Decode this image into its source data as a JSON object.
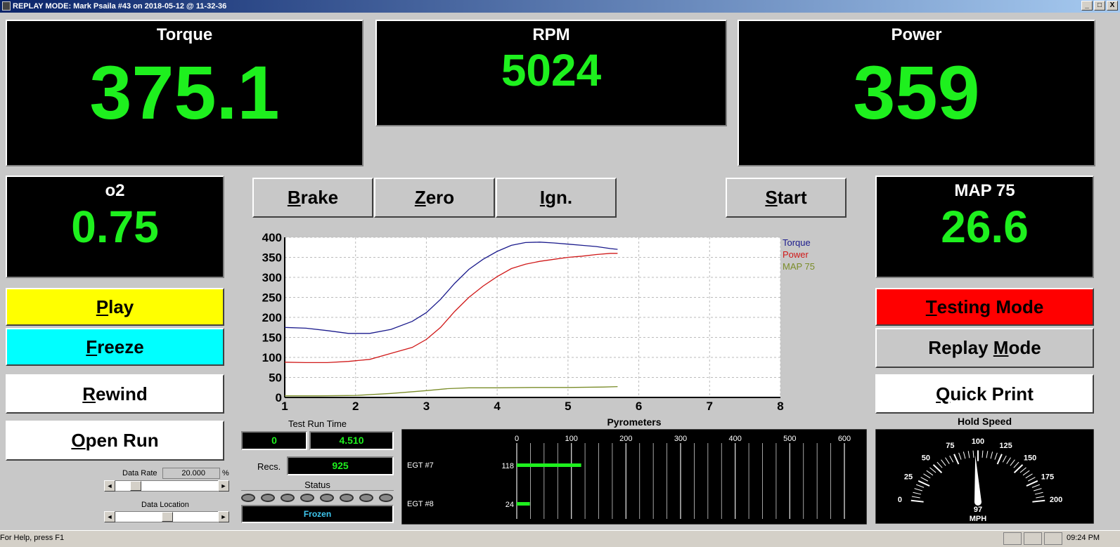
{
  "window": {
    "title": "REPLAY MODE: Mark Psaila #43 on 2018-05-12 @ 11-32-36",
    "min": "_",
    "max": "□",
    "close": "X"
  },
  "torque": {
    "label": "Torque",
    "value": "375.1"
  },
  "rpm": {
    "label": "RPM",
    "value": "5024"
  },
  "power": {
    "label": "Power",
    "value": "359"
  },
  "o2": {
    "label": "o2",
    "value": "0.75"
  },
  "map": {
    "label": "MAP 75",
    "value": "26.6"
  },
  "buttons": {
    "brake": {
      "first": "B",
      "rest": "rake"
    },
    "zero": {
      "first": "Z",
      "rest": "ero"
    },
    "ign": {
      "first": "I",
      "rest": "gn."
    },
    "start": {
      "first": "S",
      "rest": "tart"
    },
    "play": {
      "first": "P",
      "rest": "lay"
    },
    "freeze": {
      "first": "F",
      "rest": "reeze"
    },
    "rewind": {
      "first": "R",
      "rest": "ewind"
    },
    "open_run": {
      "first": "O",
      "rest": "pen Run"
    },
    "testing_mode": {
      "first": "T",
      "rest": "esting Mode"
    },
    "replay_mode": {
      "pre": "Replay ",
      "u": "M",
      "post": "ode"
    },
    "quick_print": {
      "first": "Q",
      "rest": "uick Print"
    }
  },
  "colors": {
    "torque": "#1a1a8c",
    "power": "#d01818",
    "map": "#7a8c28",
    "digits": "#1ef01e",
    "play": "#ffff00",
    "freeze": "#00ffff",
    "testing": "#ff0000"
  },
  "chart_data": {
    "type": "line",
    "xlim": [
      1,
      8
    ],
    "ylim": [
      0,
      400
    ],
    "xticks": [
      "1",
      "2",
      "3",
      "4",
      "5",
      "6",
      "7",
      "8"
    ],
    "yticks": [
      "0",
      "50",
      "100",
      "150",
      "200",
      "250",
      "300",
      "350",
      "400"
    ],
    "grid": true,
    "legend": "top-right",
    "series": [
      {
        "name": "Torque",
        "x": [
          1,
          1.3,
          1.6,
          1.9,
          2.2,
          2.5,
          2.8,
          3.0,
          3.2,
          3.4,
          3.6,
          3.8,
          4.0,
          4.2,
          4.4,
          4.6,
          4.8,
          5.0,
          5.2,
          5.4,
          5.6,
          5.7
        ],
        "y": [
          175,
          173,
          167,
          160,
          160,
          170,
          190,
          212,
          245,
          285,
          320,
          345,
          365,
          380,
          387,
          388,
          386,
          383,
          380,
          377,
          372,
          370
        ]
      },
      {
        "name": "Power",
        "x": [
          1,
          1.3,
          1.6,
          1.9,
          2.2,
          2.5,
          2.8,
          3.0,
          3.2,
          3.4,
          3.6,
          3.8,
          4.0,
          4.2,
          4.4,
          4.6,
          4.8,
          5.0,
          5.2,
          5.4,
          5.6,
          5.7
        ],
        "y": [
          88,
          87,
          87,
          90,
          95,
          110,
          125,
          145,
          175,
          215,
          250,
          278,
          302,
          322,
          333,
          340,
          345,
          350,
          353,
          357,
          360,
          360
        ]
      },
      {
        "name": "MAP 75",
        "x": [
          1,
          1.5,
          2.0,
          2.5,
          3.0,
          3.3,
          3.6,
          4.0,
          4.5,
          5.0,
          5.5,
          5.7
        ],
        "y": [
          4,
          4,
          5,
          10,
          17,
          22,
          24,
          24,
          25,
          25,
          26,
          27
        ]
      }
    ]
  },
  "test_run": {
    "label": "Test Run Time",
    "start": "0",
    "time": "4.510",
    "recs_label": "Recs.",
    "recs": "925",
    "status_label": "Status",
    "status": "Frozen"
  },
  "pyro": {
    "title": "Pyrometers",
    "ticks": [
      "0",
      "100",
      "200",
      "300",
      "400",
      "500",
      "600"
    ],
    "max": 600,
    "rows": [
      {
        "name": "EGT #7",
        "value": "118",
        "num": 118
      },
      {
        "name": "EGT #8",
        "value": "24",
        "num": 24
      }
    ]
  },
  "data_rate": {
    "label": "Data Rate",
    "value": "20.000",
    "unit": "%",
    "pos": 0.15
  },
  "data_location": {
    "label": "Data Location",
    "pos": 0.5
  },
  "speedo": {
    "title": "Hold Speed",
    "ticks": [
      "0",
      "25",
      "50",
      "75",
      "100",
      "125",
      "150",
      "175",
      "200"
    ],
    "value": "97",
    "num": 97,
    "unit": "MPH"
  },
  "statusbar": {
    "help": "For Help, press F1",
    "time": "09:24 PM"
  }
}
